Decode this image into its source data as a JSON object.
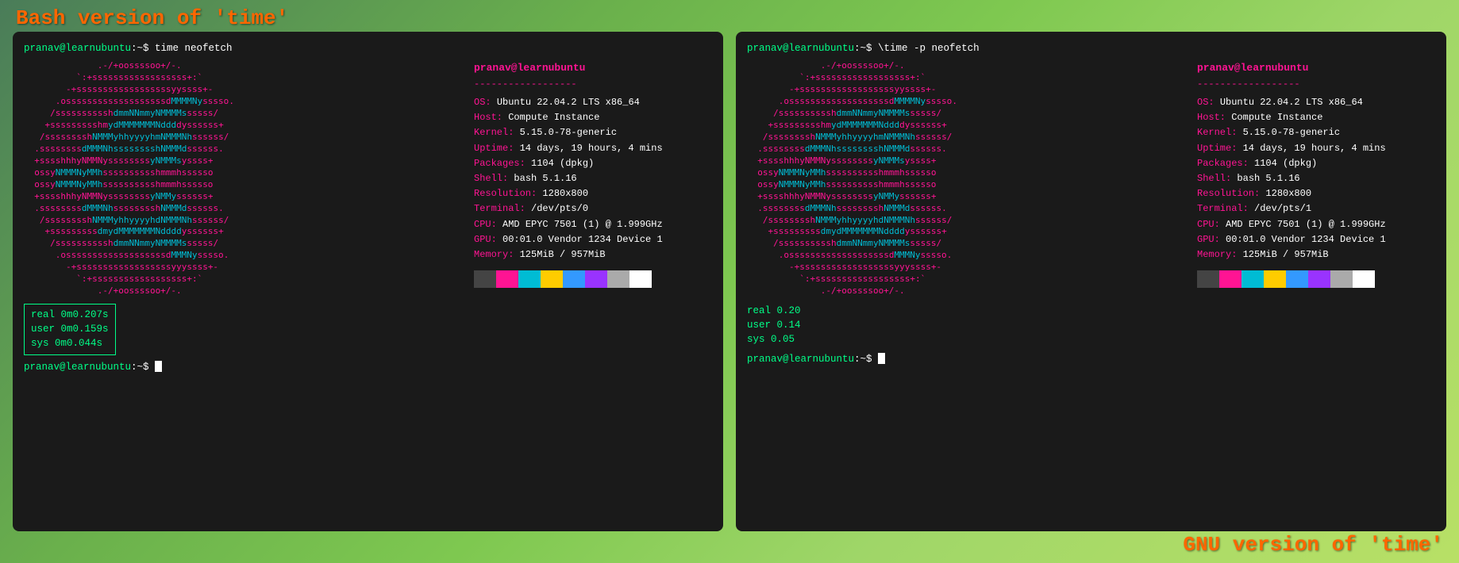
{
  "title_top": "Bash version of 'time'",
  "title_bottom": "GNU version of 'time'",
  "left_terminal": {
    "prompt": "pranav@learnubuntu:~$ time neofetch",
    "neofetch_art": [
      "              .-/+oossssoo+/-.",
      "          `:+ssssssssssssssssss+:`",
      "        -+ssssssssssssssssssyyssss+-",
      "      .osssssssssssssssssssdMMMMNysssso.",
      "     /ssssssssssshdmmNNmmyNMMMMhssssss/",
      "    +ssssssssshmydMMMMMMMNddddyssssss+",
      "   /sssssssshNMMMyhhyyyyhmNMMMNhssssss/",
      "  .ssssssssdMMMNhsssssssshNMMMdssssss.",
      "  +sssshhhyNMMNyssssssssyNMMMysssss+",
      "  ossyNMMMNyMMhsssssssssshmmmhssssso",
      "  ossyNMMMNyMMhsssssssssshmmmhssssso",
      "  +sssshhhyNMMNyssssssssyNMMMysssss+",
      "  .ssssssssdMMMNhsssssssshNMMMdssssss.",
      "   /sssssssshNMMMyhhyyyyhdNMMMNhssssss/",
      "    +sssssssssdmydMMMMMMMNddddyssssss+",
      "     /ssssssssssshdmmNNmmyNMMMMhssssss/",
      "      .osssssssssssssssssssdMMMNysssso.",
      "        -+sssssssssssssssssyyyssss+-",
      "          `:+ssssssssssssssssss+:`",
      "              .-/+oossssoo+/-."
    ],
    "time_result": {
      "real": "real\t0m0.207s",
      "user": "user\t0m0.159s",
      "sys": "sys \t0m0.044s"
    },
    "bottom_prompt": "pranav@learnubuntu:~$ "
  },
  "right_terminal": {
    "prompt": "pranav@learnubuntu:~$ \\time -p neofetch",
    "neofetch_art": [
      "              .-/+oossssoo+/-.",
      "          `:+ssssssssssssssssss+:`",
      "        -+ssssssssssssssssssyyssss+-",
      "      .osssssssssssssssssssdMMMMNysssso.",
      "     /ssssssssssshdmmNNmmyNMMMMhssssss/",
      "    +ssssssssshmydMMMMMMMNddddyssssss+",
      "   /sssssssshNMMMyhhyyyyhmNMMMNhssssss/",
      "  .ssssssssdMMMNhsssssssshNMMMdssssss.",
      "  +sssshhhyNMMNyssssssssyNMMMysssss+",
      "  ossyNMMMNyMMhsssssssssshmmmhssssso",
      "  ossyNMMMNyMMhsssssssssshmmmhssssso",
      "  +sssshhhyNMMNyssssssssyNMMMysssss+",
      "  .ssssssssdMMMNhsssssssshNMMMdssssss.",
      "   /sssssssshNMMMyhhyyyyhdNMMMNhssssss/",
      "    +sssssssssdmydMMMMMMMNddddyssssss+",
      "     /ssssssssssshdmmNNmmyNMMMMhssssss/",
      "      .osssssssssssssssssssdMMMNysssso.",
      "        -+sssssssssssssssssyyyssss+-",
      "          `:+ssssssssssssssssss+:`",
      "              .-/+oossssoo+/-."
    ],
    "time_result": {
      "real": "real 0.20",
      "user": "user 0.14",
      "sys": "sys 0.05"
    },
    "bottom_prompt": "pranav@learnubuntu:~$ "
  },
  "neofetch_info": {
    "title": "pranav@learnubuntu",
    "divider": "------------------",
    "items": [
      {
        "key": "OS",
        "val": "Ubuntu 22.04.2 LTS x86_64"
      },
      {
        "key": "Host",
        "val": "Compute Instance"
      },
      {
        "key": "Kernel",
        "val": "5.15.0-78-generic"
      },
      {
        "key": "Uptime",
        "val": "14 days, 19 hours, 4 mins"
      },
      {
        "key": "Packages",
        "val": "1104 (dpkg)"
      },
      {
        "key": "Shell",
        "val": "bash 5.1.16"
      },
      {
        "key": "Resolution",
        "val": "1280x800"
      },
      {
        "key": "Terminal",
        "val": "/dev/pts/0"
      },
      {
        "key": "CPU",
        "val": "AMD EPYC 7501 (1) @ 1.999GHz"
      },
      {
        "key": "GPU",
        "val": "00:01.0 Vendor 1234 Device 1"
      },
      {
        "key": "Memory",
        "val": "125MiB / 957MiB"
      }
    ]
  },
  "neofetch_info_right": {
    "title": "pranav@learnubuntu",
    "divider": "------------------",
    "items": [
      {
        "key": "OS",
        "val": "Ubuntu 22.04.2 LTS x86_64"
      },
      {
        "key": "Host",
        "val": "Compute Instance"
      },
      {
        "key": "Kernel",
        "val": "5.15.0-78-generic"
      },
      {
        "key": "Uptime",
        "val": "14 days, 19 hours, 4 mins"
      },
      {
        "key": "Packages",
        "val": "1104 (dpkg)"
      },
      {
        "key": "Shell",
        "val": "bash 5.1.16"
      },
      {
        "key": "Resolution",
        "val": "1280x800"
      },
      {
        "key": "Terminal",
        "val": "/dev/pts/1"
      },
      {
        "key": "CPU",
        "val": "AMD EPYC 7501 (1) @ 1.999GHz"
      },
      {
        "key": "GPU",
        "val": "00:01.0 Vendor 1234 Device 1"
      },
      {
        "key": "Memory",
        "val": "125MiB / 957MiB"
      }
    ]
  },
  "colors": {
    "accent": "#ff6600",
    "terminal_bg": "#1a1a1a",
    "prompt_green": "#00ff88",
    "art_pink": "#ff1493",
    "art_cyan": "#00bcd4"
  },
  "color_palette": [
    "#444444",
    "#ff1493",
    "#00bcd4",
    "#ffcc00",
    "#3399ff",
    "#9933ff",
    "#aaaaaa",
    "#ffffff"
  ]
}
